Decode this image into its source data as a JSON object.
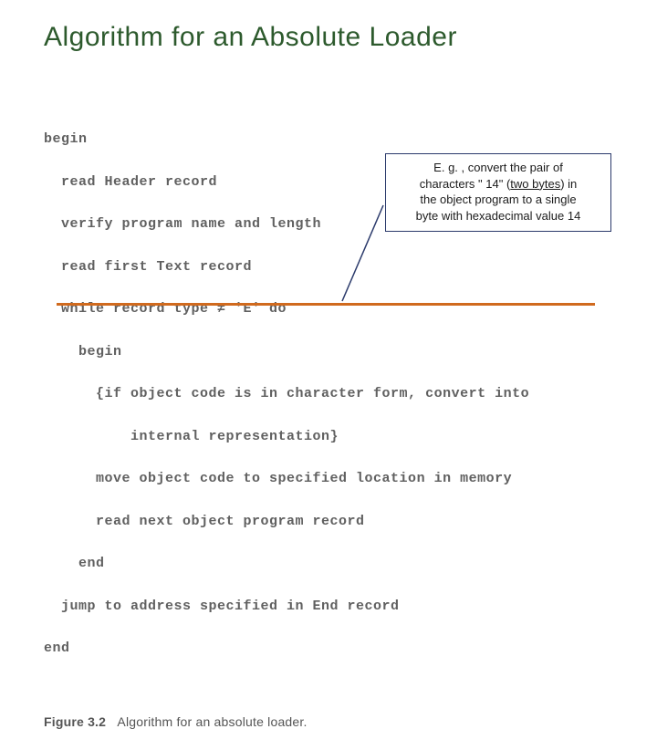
{
  "title": "Algorithm for an Absolute Loader",
  "callout": {
    "line1_prefix": "E. g. , convert the pair of",
    "line2_prefix": "characters ",
    "quoted": "\" 14\"",
    "line2_mid": " (",
    "underlined": "two bytes",
    "line2_suffix": ") in",
    "line3": "the object program to a single",
    "line4": "byte with hexadecimal value 14"
  },
  "code": {
    "l01": "begin",
    "l02": "  read Header record",
    "l03": "  verify program name and length",
    "l04": "  read first Text record",
    "l05": "  while record type ≠ 'E' do",
    "l06": "    begin",
    "l07": "      {if object code is in character form, convert into",
    "l08": "          internal representation}",
    "l09": "      move object code to specified location in memory",
    "l10": "      read next object program record",
    "l11": "    end",
    "l12": "  jump to address specified in End record",
    "l13": "end"
  },
  "figure": {
    "label": "Figure 3.2",
    "caption": "Algorithm for an absolute loader."
  }
}
